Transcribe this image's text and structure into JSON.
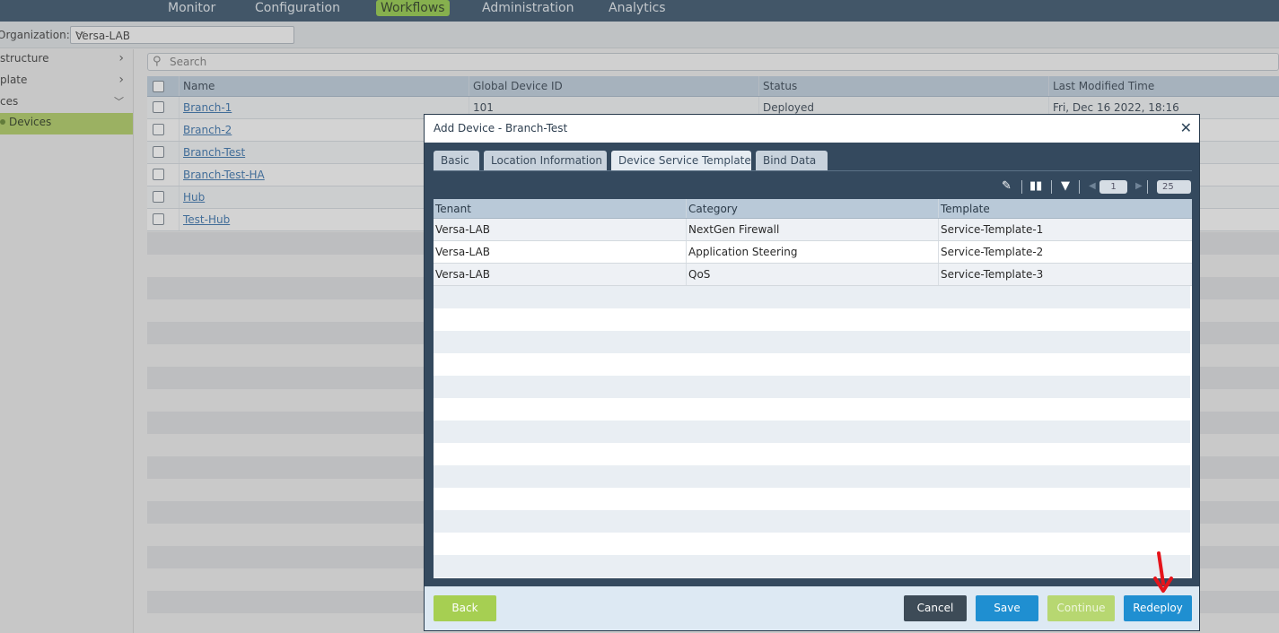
{
  "topnav": {
    "items": [
      "Monitor",
      "Configuration",
      "Workflows",
      "Administration",
      "Analytics"
    ],
    "active": "Workflows"
  },
  "org": {
    "label": "Organization:",
    "value": "Versa-LAB"
  },
  "sidebar": {
    "items": [
      {
        "label": "Infrastructure",
        "shown": "structure"
      },
      {
        "label": "Template",
        "shown": "plate"
      },
      {
        "label": "Devices",
        "shown": "ces"
      },
      {
        "label": "Devices",
        "shown": "Devices"
      }
    ]
  },
  "search": {
    "placeholder": "Search"
  },
  "devices_table": {
    "columns": [
      "Name",
      "Global Device ID",
      "Status",
      "Last Modified Time"
    ],
    "rows": [
      {
        "name": "Branch-1",
        "id": "101",
        "status": "Deployed",
        "modified": "Fri, Dec 16 2022, 18:16"
      },
      {
        "name": "Branch-2",
        "id": "",
        "status": "",
        "modified": ""
      },
      {
        "name": "Branch-Test",
        "id": "",
        "status": "",
        "modified": ""
      },
      {
        "name": "Branch-Test-HA",
        "id": "",
        "status": "",
        "modified": ""
      },
      {
        "name": "Hub",
        "id": "",
        "status": "",
        "modified": ""
      },
      {
        "name": "Test-Hub",
        "id": "",
        "status": "",
        "modified": ""
      }
    ]
  },
  "modal": {
    "title": "Add Device - Branch-Test",
    "close_icon": "close-icon",
    "tabs": [
      "Basic",
      "Location Information",
      "Device Service Template",
      "Bind Data"
    ],
    "active_tab": "Device Service Template",
    "pager": {
      "page": "1",
      "page_size": "25"
    },
    "table": {
      "columns": [
        "Tenant",
        "Category",
        "Template"
      ],
      "rows": [
        {
          "tenant": "Versa-LAB",
          "category": "NextGen Firewall",
          "template": "Service-Template-1"
        },
        {
          "tenant": "Versa-LAB",
          "category": "Application Steering",
          "template": "Service-Template-2"
        },
        {
          "tenant": "Versa-LAB",
          "category": "QoS",
          "template": "Service-Template-3"
        }
      ]
    },
    "buttons": {
      "back": "Back",
      "cancel": "Cancel",
      "save": "Save",
      "continue": "Continue",
      "redeploy": "Redeploy"
    }
  },
  "colors": {
    "nav_bg": "#2f4a63",
    "accent_green": "#8dc63f",
    "primary_blue": "#1f8fd1",
    "modal_bg": "#34495e",
    "annotation_red": "#e5141b"
  }
}
